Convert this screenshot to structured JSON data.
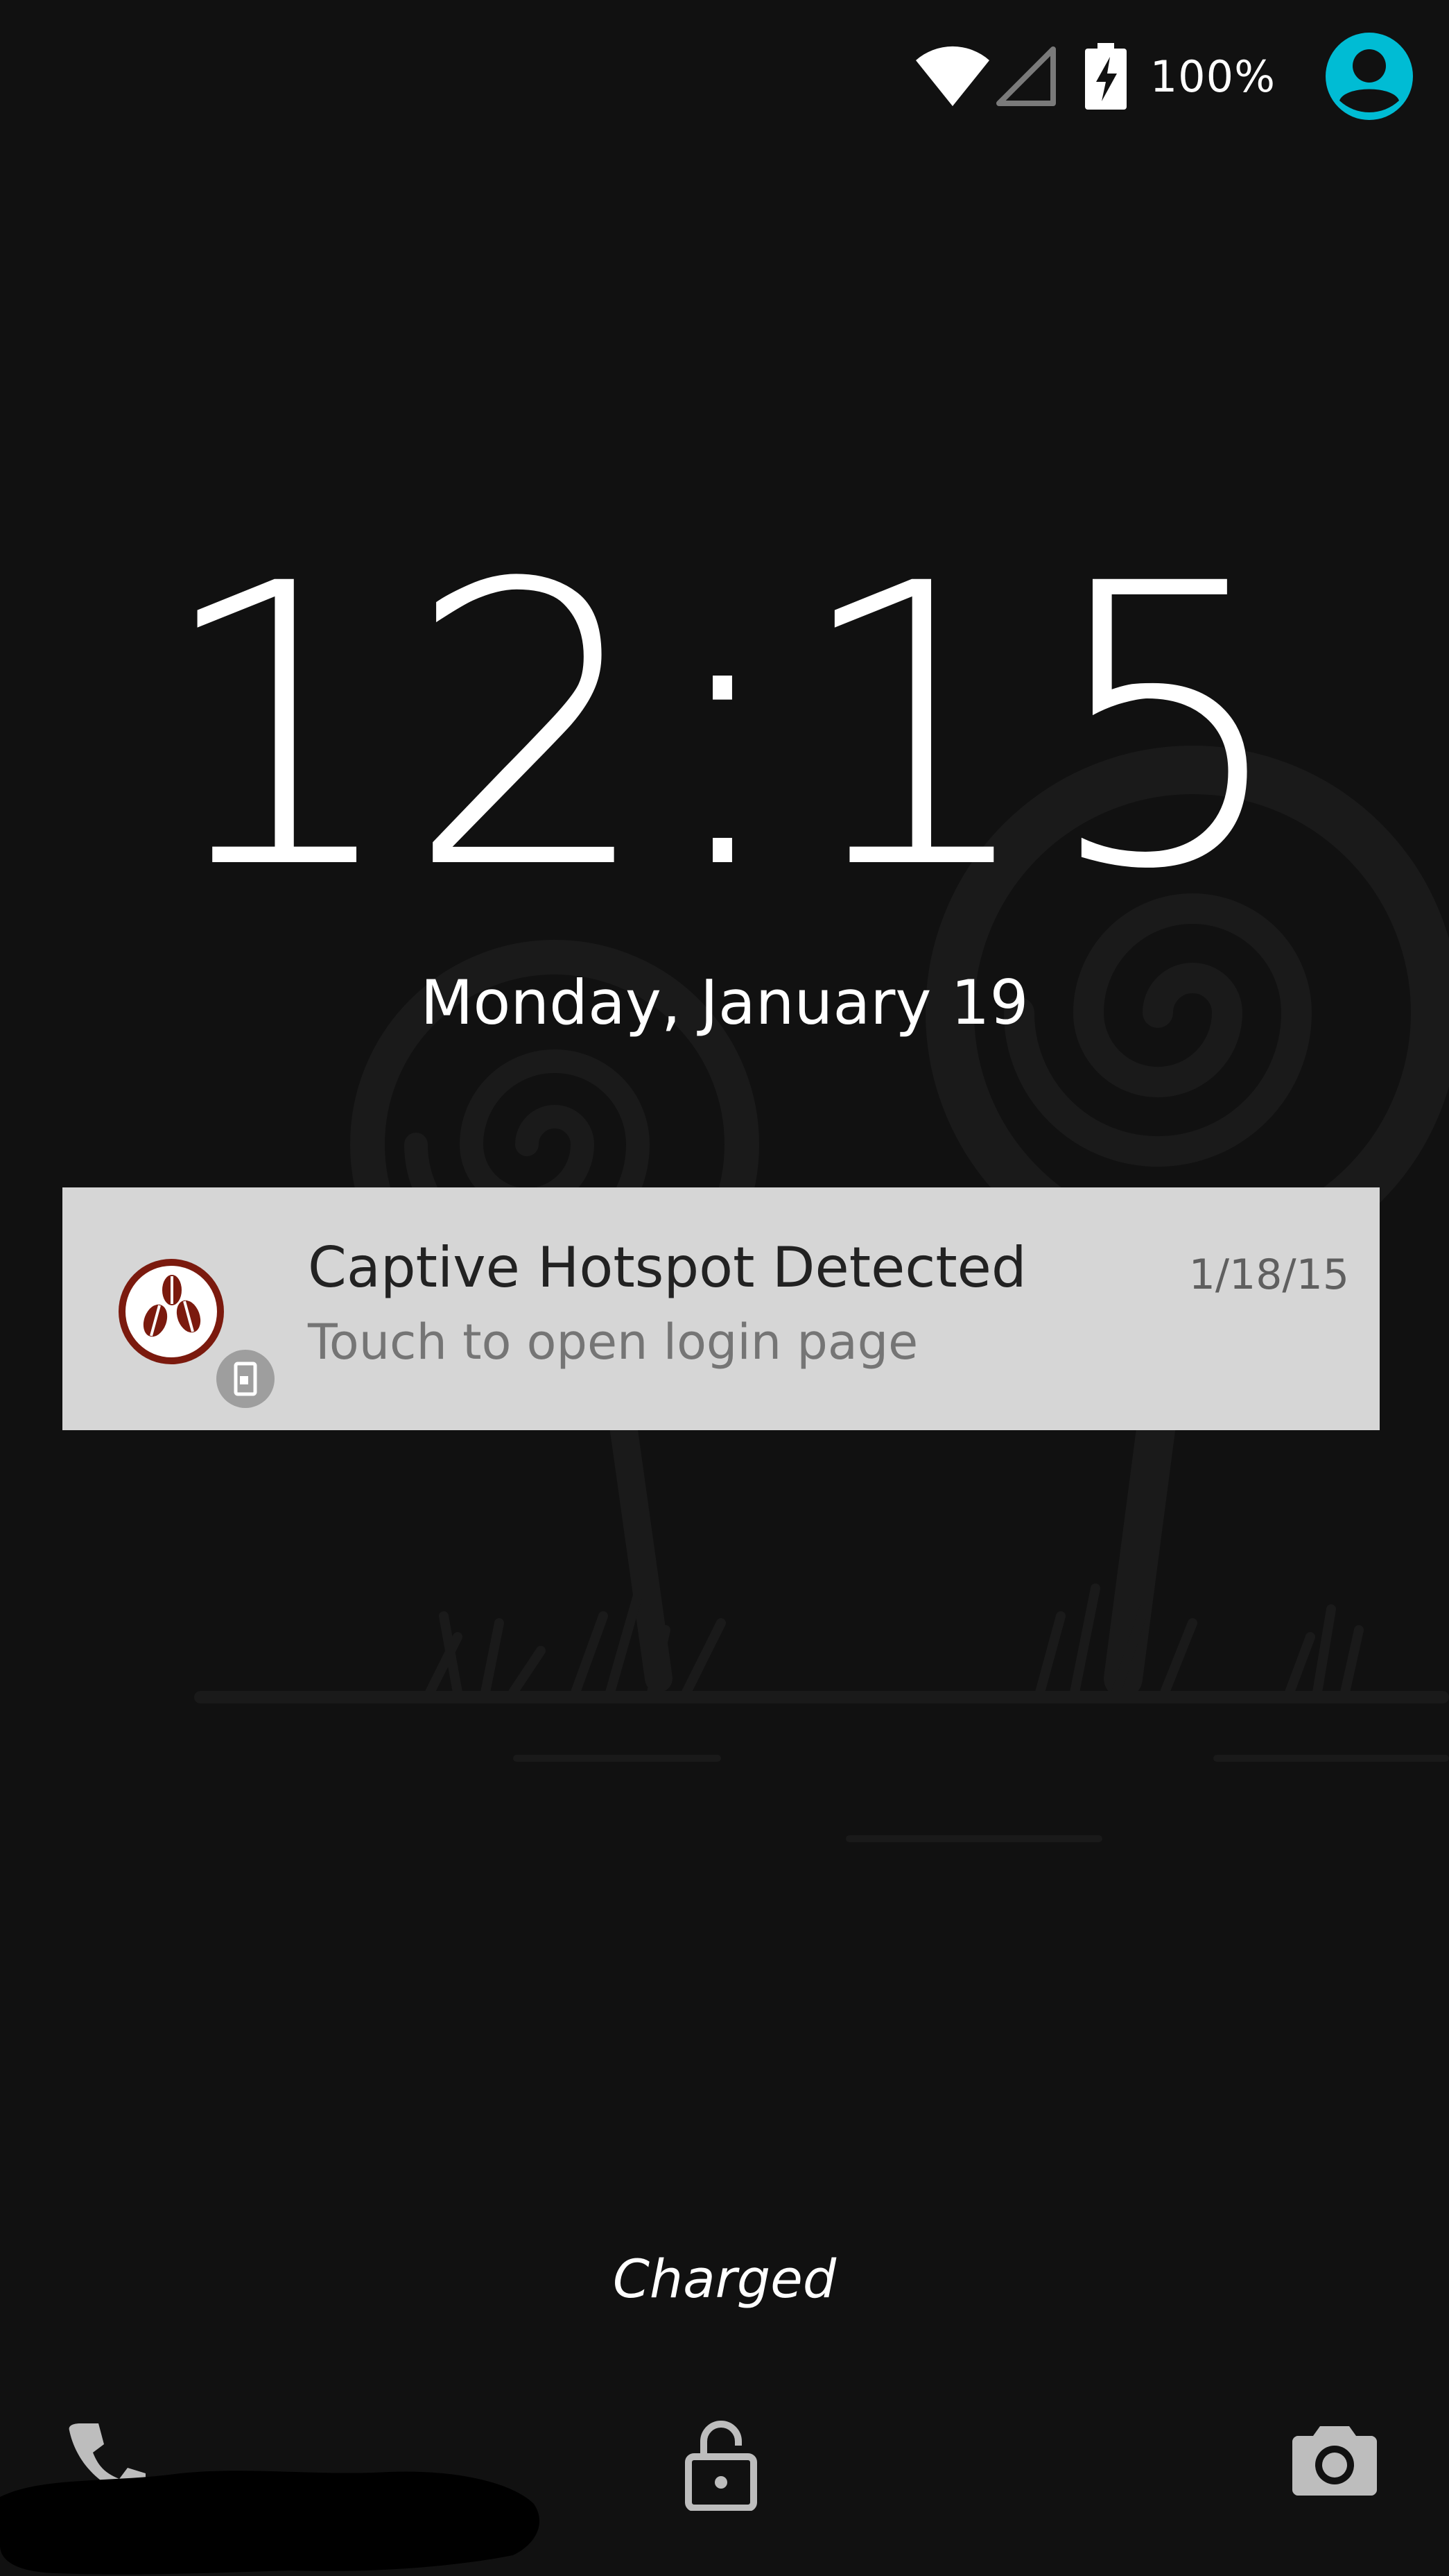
{
  "status_bar": {
    "battery_level_text": "100%",
    "icons": [
      "wifi-icon",
      "cellular-signal-icon",
      "battery-charging-icon",
      "user-avatar-icon"
    ],
    "accent_color": "#00bcd4"
  },
  "lock_screen": {
    "clock": "12:15",
    "date": "Monday, January 19",
    "charging_status": "Charged"
  },
  "notification": {
    "title": "Captive Hotspot Detected",
    "text": "Touch to open login page",
    "time": "1/18/15",
    "app_icon": "coffee-beans-icon",
    "small_icon": "hotspot-icon",
    "app_icon_color": "#7b1a0e",
    "background_color": "#d6d6d6"
  },
  "bottom_bar": {
    "left": "phone-icon",
    "center": "unlock-icon",
    "right": "camera-icon"
  }
}
